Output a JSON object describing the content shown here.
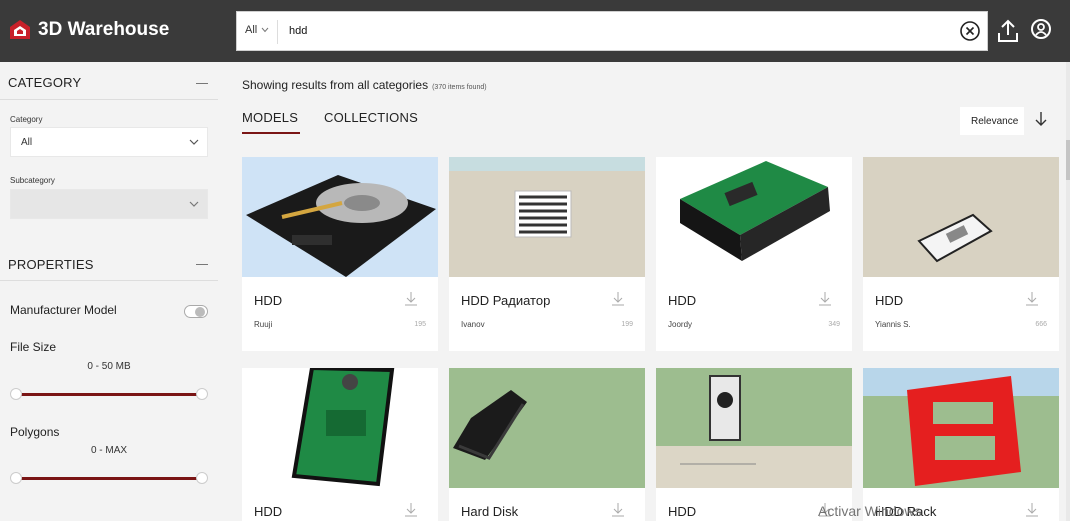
{
  "app": {
    "name": "3D Warehouse"
  },
  "search": {
    "scope": "All",
    "query": "hdd"
  },
  "sidebar": {
    "category_heading": "CATEGORY",
    "category_label": "Category",
    "category_value": "All",
    "subcategory_label": "Subcategory",
    "properties_heading": "PROPERTIES",
    "manufacturer_label": "Manufacturer Model",
    "manufacturer_enabled": false,
    "file_size_label": "File Size",
    "file_size_range": "0 - 50 MB",
    "polygons_label": "Polygons",
    "polygons_range": "0 - MAX"
  },
  "results": {
    "heading": "Showing results from all categories",
    "count": "(370 items found)",
    "tabs": [
      {
        "label": "MODELS",
        "active": true
      },
      {
        "label": "COLLECTIONS",
        "active": false
      }
    ],
    "sort_label": "Relevance"
  },
  "cards": [
    {
      "title": "HDD",
      "author": "Ruuji",
      "downloads": "195"
    },
    {
      "title": "HDD Радиатор",
      "author": "Ivanov",
      "downloads": "199"
    },
    {
      "title": "HDD",
      "author": "Joordy",
      "downloads": "349"
    },
    {
      "title": "HDD",
      "author": "Yiannis S.",
      "downloads": "666"
    },
    {
      "title": "HDD",
      "author": "",
      "downloads": ""
    },
    {
      "title": "Hard Disk",
      "author": "",
      "downloads": ""
    },
    {
      "title": "HDD",
      "author": "",
      "downloads": ""
    },
    {
      "title": "HDD Rack",
      "author": "",
      "downloads": ""
    }
  ],
  "watermark": "Activar Windows",
  "colors": {
    "header": "#3a3a3a",
    "accent": "#7a1515",
    "page": "#f3f3f3"
  }
}
